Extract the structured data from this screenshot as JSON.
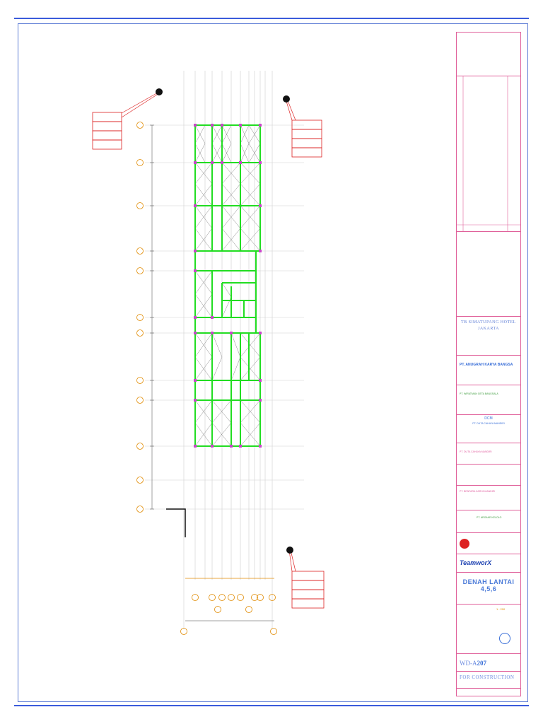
{
  "project_name": "TB SIMATUPANG HOTEL JAKARTA",
  "owner_firm": "PT. ANUGRAH KARYA BANGSA",
  "architect_firm": "PT. WIRATMAN GETA BANGSALA",
  "mep_firm_code": "DCM",
  "mep_firm": "PT. DUTA CAHAYA MANDIRI",
  "structure_firm": "PT. DUTA CAHAYA MANDIRI",
  "landscape_firm": "PT. BENTARA KARYA MANDIRI",
  "qs_firm": "PT. ARGAKE KELOLO",
  "pm_brand": "TeamworX",
  "drawing_title": "DENAH LANTAI 4,5,6",
  "drawing_number_prefix": "WD-A",
  "drawing_number": "207",
  "status": "FOR CONSTRUCTION",
  "scale": "1 : 200",
  "colors": {
    "border_blue": "#3b5bdb",
    "frame_green": "#22dd22",
    "callout_red": "#dd2222",
    "grid_orange": "#e08a00",
    "title_pink": "#e0609a",
    "column_magenta": "#cc44cc"
  }
}
